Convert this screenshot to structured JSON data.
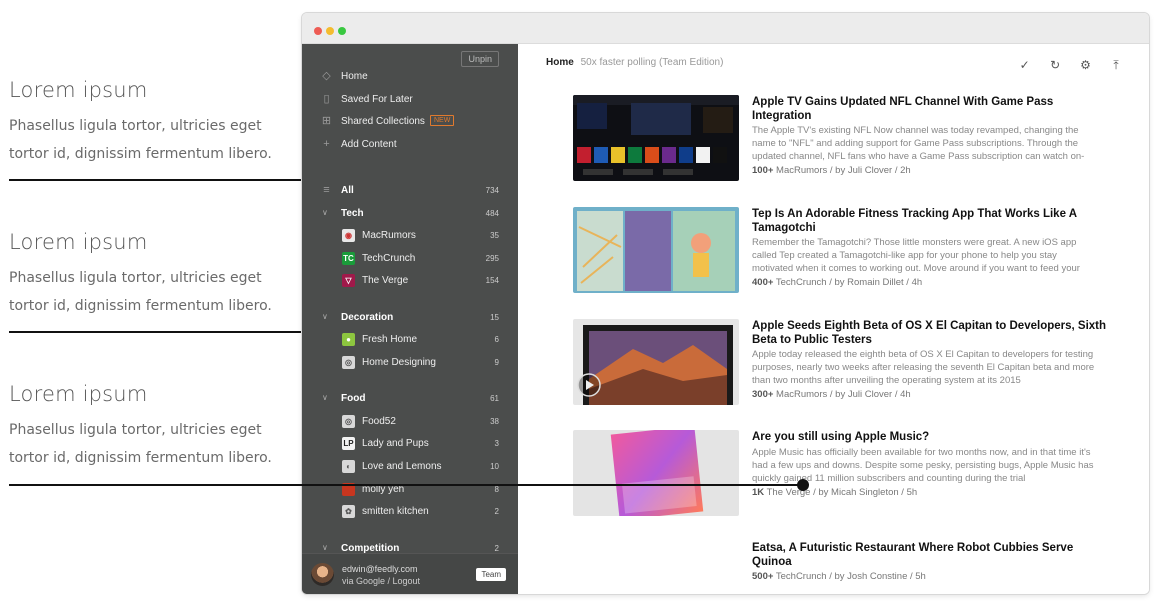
{
  "annotations": [
    {
      "title": "Lorem ipsum",
      "desc": "Phasellus ligula tortor, ultricies eget tortor id, dignissim fermentum libero."
    },
    {
      "title": "Lorem ipsum",
      "desc": "Phasellus ligula tortor, ultricies eget tortor id, dignissim fermentum libero."
    },
    {
      "title": "Lorem ipsum",
      "desc": "Phasellus ligula tortor, ultricies eget tortor id, dignissim fermentum libero."
    }
  ],
  "sidebar": {
    "unpin_label": "Unpin",
    "nav": {
      "home": "Home",
      "saved": "Saved For Later",
      "shared": "Shared Collections",
      "new_badge": "NEW",
      "add": "Add Content"
    },
    "all": {
      "label": "All",
      "count": "734"
    },
    "tech": {
      "label": "Tech",
      "count": "484"
    },
    "macrumors": {
      "label": "MacRumors",
      "count": "35"
    },
    "techcrunch": {
      "label": "TechCrunch",
      "count": "295"
    },
    "verge": {
      "label": "The Verge",
      "count": "154"
    },
    "decoration": {
      "label": "Decoration",
      "count": "15"
    },
    "freshhome": {
      "label": "Fresh Home",
      "count": "6"
    },
    "homedesigning": {
      "label": "Home Designing",
      "count": "9"
    },
    "food": {
      "label": "Food",
      "count": "61"
    },
    "food52": {
      "label": "Food52",
      "count": "38"
    },
    "ladypups": {
      "label": "Lady and Pups",
      "count": "3"
    },
    "lovelemons": {
      "label": "Love and Lemons",
      "count": "10"
    },
    "mollyyeh": {
      "label": "molly yeh",
      "count": "8"
    },
    "smitten": {
      "label": "smitten kitchen",
      "count": "2"
    },
    "competition": {
      "label": "Competition",
      "count": "2"
    },
    "footer": {
      "email": "edwin@feedly.com",
      "via": "via Google / Logout",
      "team": "Team"
    }
  },
  "main": {
    "header_home": "Home",
    "header_sub": "50x faster polling (Team Edition)",
    "icons": [
      "check-icon",
      "refresh-icon",
      "gear-icon",
      "collapse-icon"
    ],
    "articles": [
      {
        "title": "Apple TV Gains Updated NFL Channel With Game Pass Integration",
        "desc": "The Apple TV's existing NFL Now channel was today revamped, changing the name to \"NFL\" and adding support for Game Pass subscriptions. Through the updated channel, NFL fans who have a Game Pass subscription can watch on-",
        "count": "100+",
        "source": "MacRumors / by Juli Clover / 2h"
      },
      {
        "title": "Tep Is An Adorable Fitness Tracking App That Works Like A Tamagotchi",
        "desc": "Remember the Tamagotchi? Those little monsters were great. A new iOS app called Tep created a Tamagotchi-like app for your phone to help you stay motivated when it comes to working out. Move around if you want to feed your",
        "count": "400+",
        "source": "TechCrunch / by Romain Dillet / 4h"
      },
      {
        "title": "Apple Seeds Eighth Beta of OS X El Capitan to Developers, Sixth Beta to Public Testers",
        "desc": "Apple today released the eighth beta of OS X El Capitan to developers for testing purposes, nearly two weeks after releasing the seventh El Capitan beta and more than two months after unveiling the operating system at its 2015",
        "count": "300+",
        "source": "MacRumors / by Juli Clover / 4h"
      },
      {
        "title": "Are you still using Apple Music?",
        "desc": "Apple Music has officially been available for two months now, and in that time it's had a few ups and downs. Despite some pesky, persisting bugs, Apple Music has quickly gained 11 million subscribers and counting during the trial",
        "count": "1K",
        "source": "The Verge / by Micah Singleton / 5h"
      },
      {
        "title": "Eatsa, A Futuristic Restaurant Where Robot Cubbies Serve Quinoa",
        "count": "500+",
        "source": "TechCrunch / by Josh Constine / 5h"
      }
    ]
  }
}
